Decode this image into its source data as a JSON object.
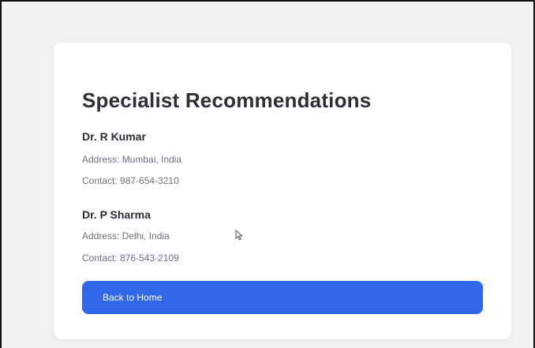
{
  "card": {
    "title": "Specialist Recommendations",
    "doctors": [
      {
        "name": "Dr. R Kumar",
        "address": "Address: Mumbai, India",
        "contact": "Contact: 987-654-3210"
      },
      {
        "name": "Dr. P Sharma",
        "address": "Address: Delhi, India",
        "contact": "Contact: 876-543-2109"
      }
    ],
    "back_button_label": "Back to Home"
  },
  "colors": {
    "page_background": "#f3f3f3",
    "card_background": "#ffffff",
    "primary_button": "#2f67e8",
    "heading_text": "#2b2f38",
    "muted_text": "#6b7280"
  },
  "icons": {
    "cursor": "mouse-pointer-icon"
  }
}
